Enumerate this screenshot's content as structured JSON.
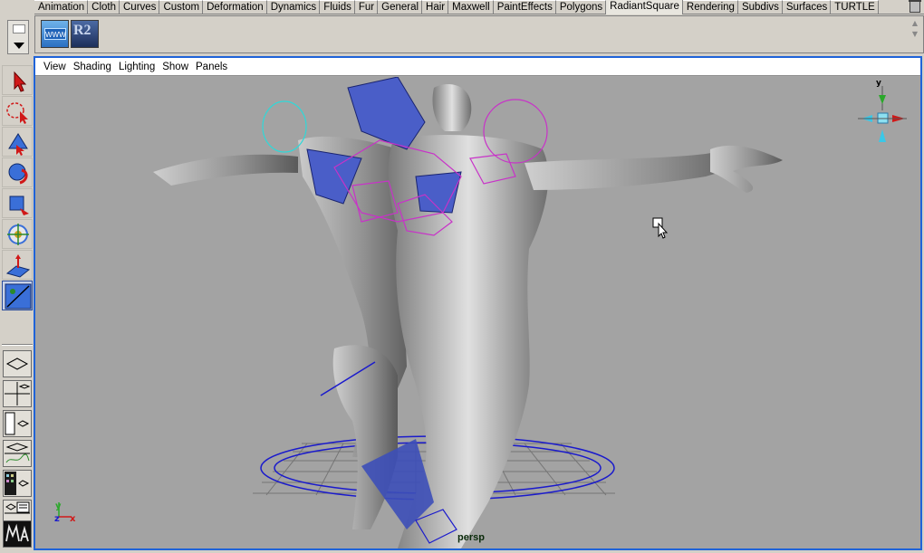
{
  "shelf_tabs": {
    "items": [
      "Animation",
      "Cloth",
      "Curves",
      "Custom",
      "Deformation",
      "Dynamics",
      "Fluids",
      "Fur",
      "General",
      "Hair",
      "Maxwell",
      "PaintEffects",
      "Polygons",
      "RadiantSquare",
      "Rendering",
      "Subdivs",
      "Surfaces",
      "TURTLE"
    ],
    "active": "RadiantSquare"
  },
  "shelf": {
    "www_icon_text": "WWW",
    "r2_icon_text": "R2"
  },
  "panel_menu": {
    "view": "View",
    "shading": "Shading",
    "lighting": "Lighting",
    "show": "Show",
    "panels": "Panels"
  },
  "viewport": {
    "camera_label": "persp",
    "axis_y": "y",
    "axis_z": "z",
    "axis_x": "x",
    "view_cube_y": "y",
    "background_color": "#a3a3a3",
    "selection_color": "#c832c8",
    "manipulator_color": "#1a1acc"
  }
}
